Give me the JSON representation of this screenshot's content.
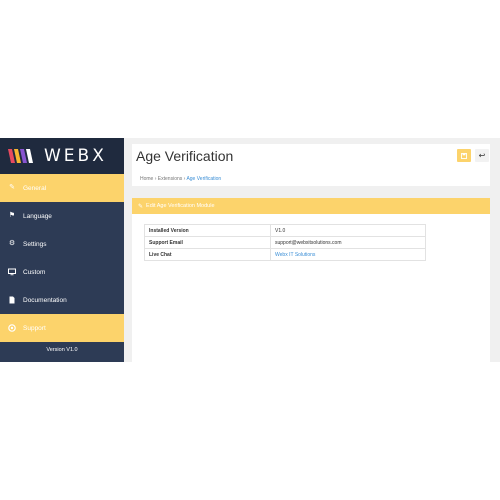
{
  "brand": {
    "name": "WEBX"
  },
  "sidebar": {
    "items": [
      {
        "label": "General",
        "icon": "edit-icon",
        "active": true
      },
      {
        "label": "Language",
        "icon": "flag-icon",
        "active": false
      },
      {
        "label": "Settings",
        "icon": "gear-icon",
        "active": false
      },
      {
        "label": "Custom",
        "icon": "monitor-icon",
        "active": false
      },
      {
        "label": "Documentation",
        "icon": "document-icon",
        "active": false
      },
      {
        "label": "Support",
        "icon": "support-icon",
        "active": true
      }
    ],
    "version": "Version V1.0"
  },
  "header": {
    "title": "Age Verification",
    "breadcrumb": [
      "Home",
      "Extensions",
      "Age Verification"
    ]
  },
  "panel": {
    "heading": "Edit Age Verification Module"
  },
  "info_table": [
    {
      "key": "Installed Version",
      "value": "V1.0",
      "link": false
    },
    {
      "key": "Support Email",
      "value": "support@webxitsolutions.com",
      "link": false
    },
    {
      "key": "Live Chat",
      "value": "Webx IT Solutions",
      "link": true
    }
  ],
  "colors": {
    "accent": "#fcd36b",
    "sidebar": "#2d3b55",
    "link": "#3a8ed6"
  }
}
